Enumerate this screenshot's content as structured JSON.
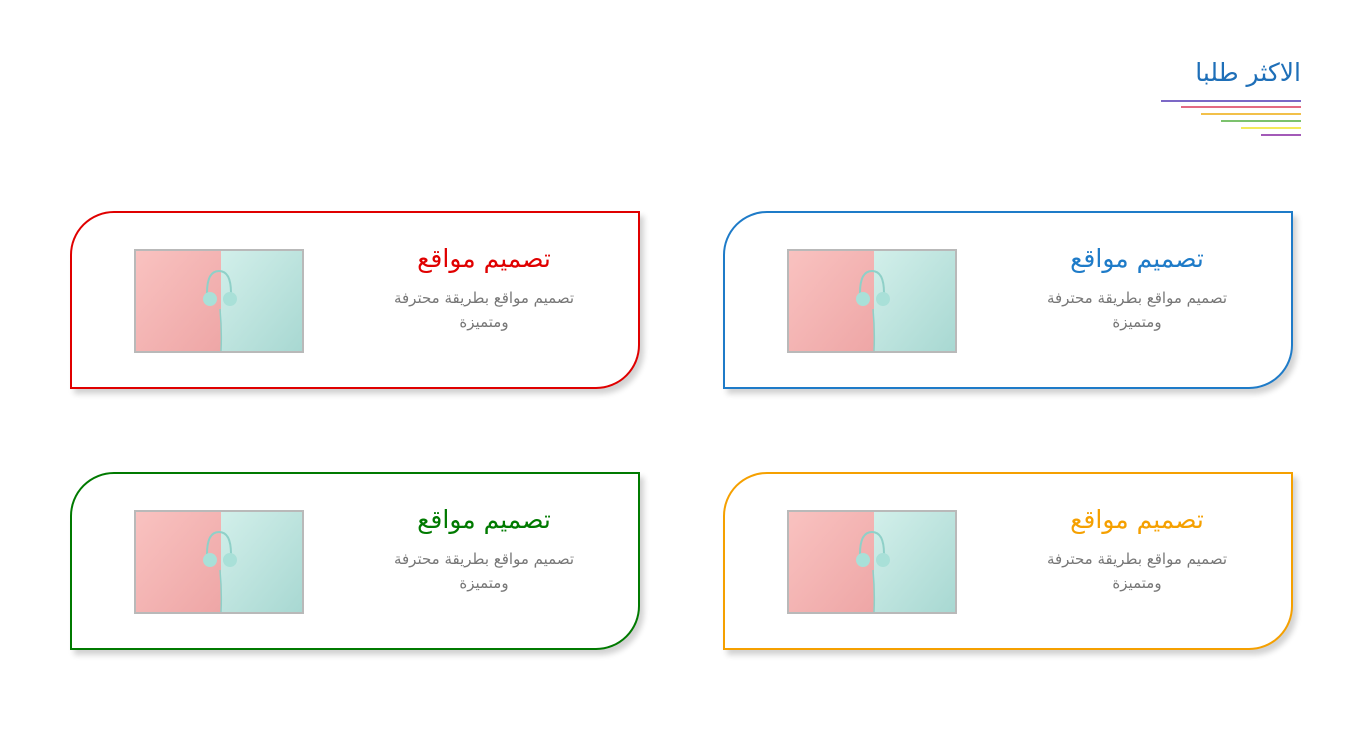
{
  "section": {
    "title": "الاكثر طلبا",
    "title_color": "#1e6fb8",
    "underline_colors": [
      "#7c68c6",
      "#e46a82",
      "#f2c04a",
      "#7cc26d",
      "#f3ea5a",
      "#a35ab8"
    ]
  },
  "cards": [
    {
      "title": "تصميم مواقع",
      "description": "تصميم مواقع بطريقة محترفة ومتميزة",
      "color": "#1e7bc8",
      "image": "headphones-image"
    },
    {
      "title": "تصميم مواقع",
      "description": "تصميم مواقع بطريقة محترفة ومتميزة",
      "color": "#e00000",
      "image": "headphones-image"
    },
    {
      "title": "تصميم مواقع",
      "description": "تصميم مواقع بطريقة محترفة ومتميزة",
      "color": "#f5a000",
      "image": "headphones-image"
    },
    {
      "title": "تصميم مواقع",
      "description": "تصميم مواقع بطريقة محترفة ومتميزة",
      "color": "#007a00",
      "image": "headphones-image"
    }
  ]
}
